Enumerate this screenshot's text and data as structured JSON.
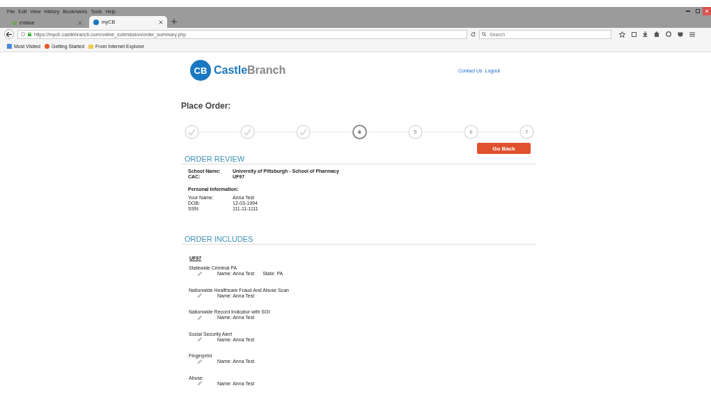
{
  "menu": [
    "File",
    "Edit",
    "View",
    "History",
    "Bookmarks",
    "Tools",
    "Help"
  ],
  "tabs": [
    {
      "label": "eValue",
      "selected": false
    },
    {
      "label": "myCB",
      "selected": true
    }
  ],
  "address": {
    "value": "https://mycb.castlebranch.com/online_submission/order_summary.php"
  },
  "search": {
    "placeholder": "Search"
  },
  "bookmarks": [
    "Most Visited",
    "Getting Started",
    "From Internet Explorer"
  ],
  "header": {
    "logo_mark": "CB",
    "logo_first": "Castle",
    "logo_second": "Branch",
    "links": [
      "Contact Us",
      "Logout"
    ]
  },
  "title": "Place Order:",
  "steps": [
    {
      "kind": "done"
    },
    {
      "kind": "done"
    },
    {
      "kind": "done"
    },
    {
      "kind": "current",
      "label": "4"
    },
    {
      "kind": "pending",
      "label": "5"
    },
    {
      "kind": "pending",
      "label": "6"
    },
    {
      "kind": "pending",
      "label": "7"
    }
  ],
  "go_back": "Go Back",
  "review": {
    "heading": "ORDER REVIEW",
    "school": [
      {
        "label": "School Name:",
        "value": "University of Pittsburgh - School of Pharmacy"
      },
      {
        "label": "CAC:",
        "value": "UF97"
      }
    ],
    "personal_heading": "Personal Information:",
    "personal": [
      {
        "label": "Your Name:",
        "value": "Anna Test"
      },
      {
        "label": "DOB:",
        "value": "12-03-1994"
      },
      {
        "label": "SSN:",
        "value": "111-11-1111"
      }
    ]
  },
  "includes": {
    "heading": "ORDER INCLUDES",
    "package": "UF97",
    "items": [
      {
        "title": "Statewide Criminal PA",
        "fields": [
          "Name: Anna Test",
          "State: PA"
        ]
      },
      {
        "title": "Nationwide Healthcare Fraud And Abuse Scan",
        "fields": [
          "Name: Anna Test"
        ]
      },
      {
        "title": "Nationwide Record Indicator with SOI",
        "fields": [
          "Name: Anna Test"
        ]
      },
      {
        "title": "Social Security Alert",
        "fields": [
          "Name: Anna Test"
        ]
      },
      {
        "title": "Fingerprint",
        "fields": [
          "Name: Anna Test"
        ]
      },
      {
        "title": "Abuse",
        "fields": [
          "Name: Anna Test"
        ]
      }
    ]
  }
}
